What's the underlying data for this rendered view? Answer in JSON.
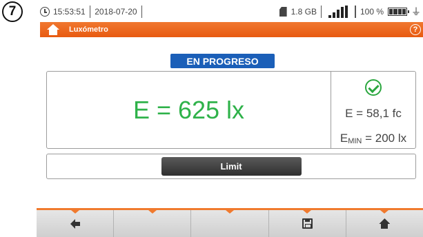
{
  "step_badge": "7",
  "statusbar": {
    "time": "15:53:51",
    "date": "2018-07-20",
    "storage": "1.8 GB",
    "battery_percent": "100 %"
  },
  "titlebar": {
    "title": "Luxómetro",
    "help_label": "?"
  },
  "status": {
    "label": "EN PROGRESO",
    "color": "#1b5fb8"
  },
  "measurement": {
    "main_value": "E = 625 lx",
    "main_color": "#2fb24a",
    "secondary_value": "E = 58,1 fc",
    "min_prefix": "E",
    "min_sub": "MIN",
    "min_suffix": " = 200 lx",
    "ok_icon": "check-circle-icon"
  },
  "limit_button": {
    "label": "Limit"
  },
  "softkeys": [
    {
      "icon": "arrow-left-icon"
    },
    {
      "icon": ""
    },
    {
      "icon": ""
    },
    {
      "icon": "save-icon"
    },
    {
      "icon": "home-icon"
    }
  ],
  "colors": {
    "accent": "#f07a2e",
    "ok": "#2aa63e"
  }
}
